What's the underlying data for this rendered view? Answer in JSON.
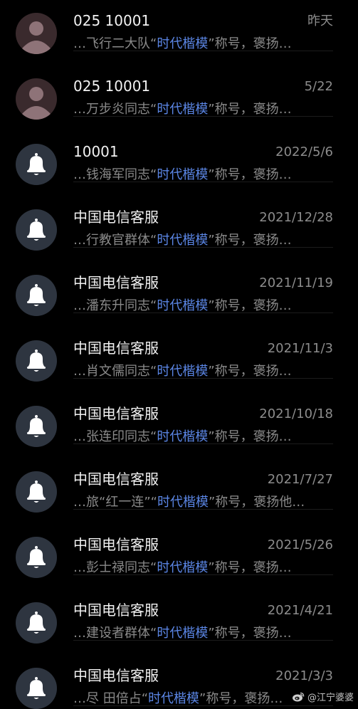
{
  "colors": {
    "background": "#000000",
    "title": "#f2f2f2",
    "secondary": "#8a8a8a",
    "highlight": "#5b86e5",
    "bell_avatar_bg": "#2e3540",
    "person_avatar_bg": "#3a2a2d"
  },
  "messages": [
    {
      "sender": "025 10001",
      "date": "昨天",
      "preview_before": "…飞行二大队“",
      "preview_highlight": "时代楷模",
      "preview_after": "”称号，褒扬…",
      "avatar": "person-icon"
    },
    {
      "sender": "025 10001",
      "date": "5/22",
      "preview_before": "…万步炎同志“",
      "preview_highlight": "时代楷模",
      "preview_after": "”称号，褒扬…",
      "avatar": "person-icon"
    },
    {
      "sender": "10001",
      "date": "2022/5/6",
      "preview_before": "…钱海军同志“",
      "preview_highlight": "时代楷模",
      "preview_after": "”称号，褒扬…",
      "avatar": "bell-icon"
    },
    {
      "sender": "中国电信客服",
      "date": "2021/12/28",
      "preview_before": "…行教官群体“",
      "preview_highlight": "时代楷模",
      "preview_after": "”称号，褒扬…",
      "avatar": "bell-icon"
    },
    {
      "sender": "中国电信客服",
      "date": "2021/11/19",
      "preview_before": "…潘东升同志“",
      "preview_highlight": "时代楷模",
      "preview_after": "”称号，褒扬…",
      "avatar": "bell-icon"
    },
    {
      "sender": "中国电信客服",
      "date": "2021/11/3",
      "preview_before": "…肖文儒同志“",
      "preview_highlight": "时代楷模",
      "preview_after": "”称号，褒扬…",
      "avatar": "bell-icon"
    },
    {
      "sender": "中国电信客服",
      "date": "2021/10/18",
      "preview_before": "…张连印同志“",
      "preview_highlight": "时代楷模",
      "preview_after": "”称号，褒扬…",
      "avatar": "bell-icon"
    },
    {
      "sender": "中国电信客服",
      "date": "2021/7/27",
      "preview_before": "…旅“红一连”“",
      "preview_highlight": "时代楷模",
      "preview_after": "”称号，褒扬他…",
      "avatar": "bell-icon"
    },
    {
      "sender": "中国电信客服",
      "date": "2021/5/26",
      "preview_before": "…彭士禄同志“",
      "preview_highlight": "时代楷模",
      "preview_after": "”称号，褒扬…",
      "avatar": "bell-icon"
    },
    {
      "sender": "中国电信客服",
      "date": "2021/4/21",
      "preview_before": "…建设者群体“",
      "preview_highlight": "时代楷模",
      "preview_after": "”称号，褒扬…",
      "avatar": "bell-icon"
    },
    {
      "sender": "中国电信客服",
      "date": "2021/3/3",
      "preview_before": "…尽 田倍占“",
      "preview_highlight": "时代楷模",
      "preview_after": "”称号，褒扬…",
      "avatar": "bell-icon"
    }
  ],
  "watermark": {
    "text": "@江宁婆婆",
    "icon": "weibo-logo-icon"
  }
}
